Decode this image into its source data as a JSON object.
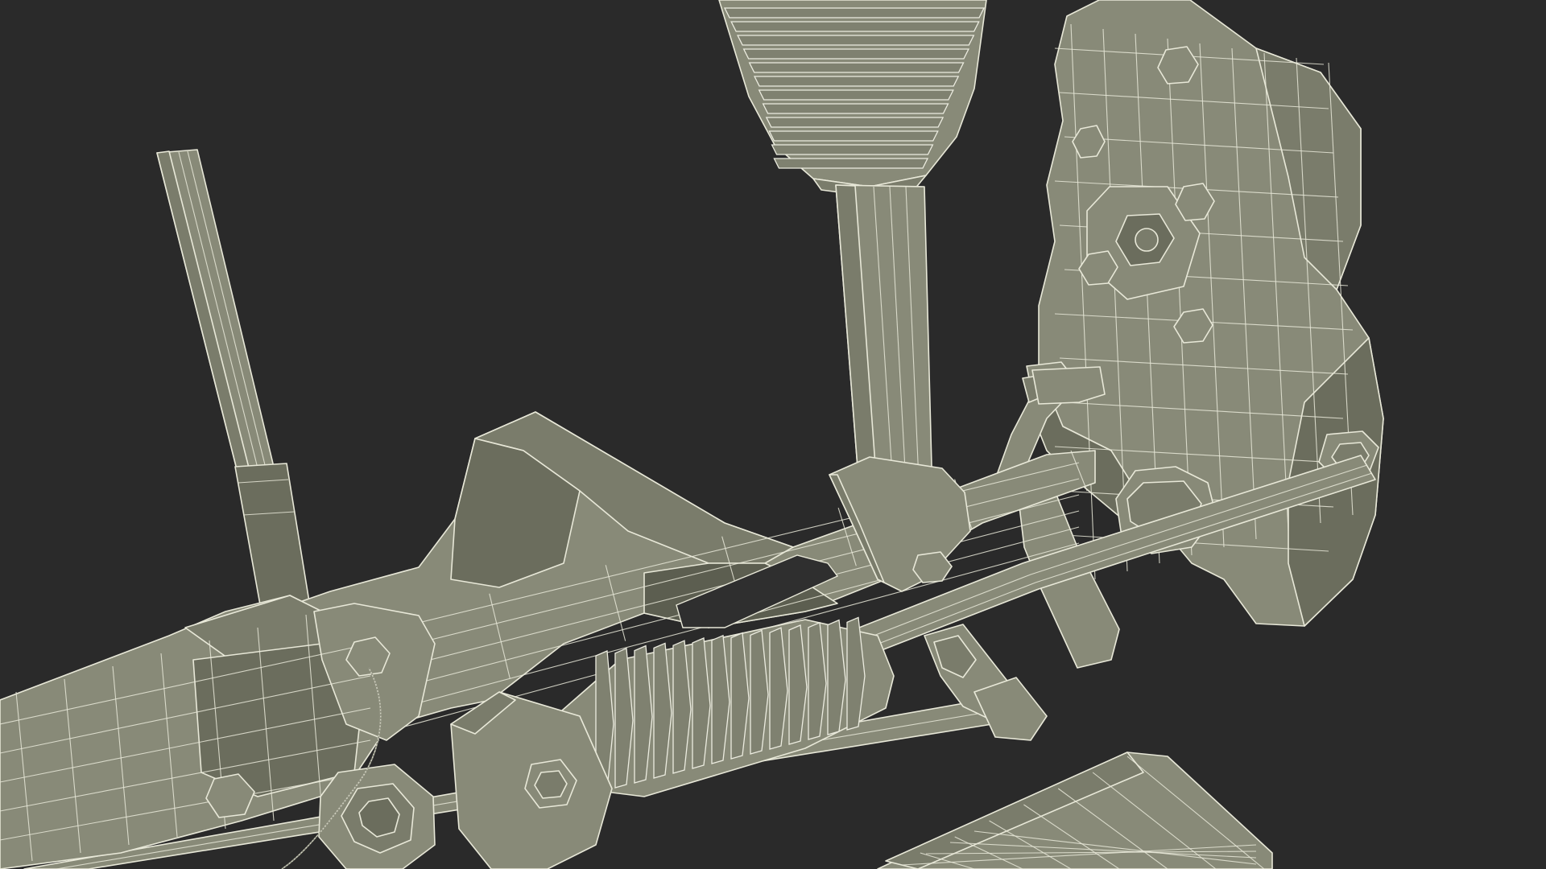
{
  "scene": {
    "background_color": "#2a2a2a",
    "mesh_fill_color": "#7a7c6b",
    "wire_color": "#e8e8d8"
  }
}
